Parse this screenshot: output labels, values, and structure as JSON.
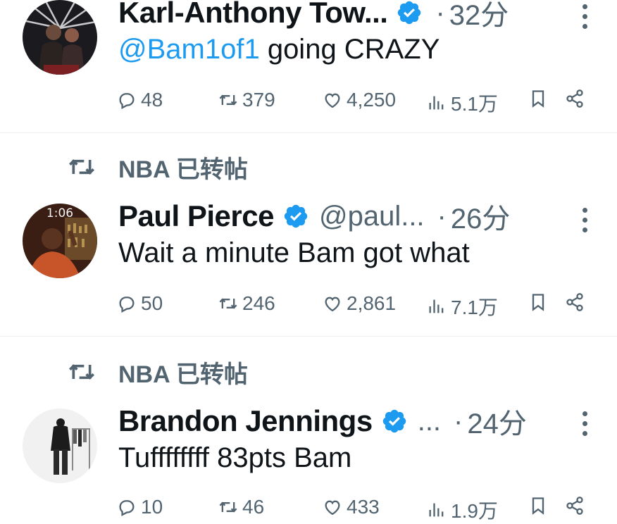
{
  "tweets": [
    {
      "name": "Karl-Anthony Tow...",
      "handle": "",
      "time": "32分",
      "mention": "@Bam1of1",
      "text": " going CRAZY",
      "replies": "48",
      "retweets": "379",
      "likes": "4,250",
      "views": "5.1万"
    },
    {
      "retweeted_by": "NBA 已转帖",
      "name": "Paul Pierce",
      "handle": "@paul...",
      "time": "26分",
      "avatar_time": "1:06",
      "text": "Wait a minute Bam got what",
      "replies": "50",
      "retweets": "246",
      "likes": "2,861",
      "views": "7.1万"
    },
    {
      "retweeted_by": "NBA 已转帖",
      "name": "Brandon Jennings",
      "handle": "...",
      "time": "24分",
      "text": "Tuffffffff 83pts Bam",
      "replies": "10",
      "retweets": "46",
      "likes": "433",
      "views": "1.9万"
    }
  ],
  "colors": {
    "accent": "#1d9bf0",
    "secondary": "#536471",
    "text": "#0f1419"
  },
  "icons": [
    "verified-badge-icon",
    "reply-icon",
    "retweet-icon",
    "like-icon",
    "views-icon",
    "bookmark-icon",
    "share-icon",
    "more-icon"
  ]
}
